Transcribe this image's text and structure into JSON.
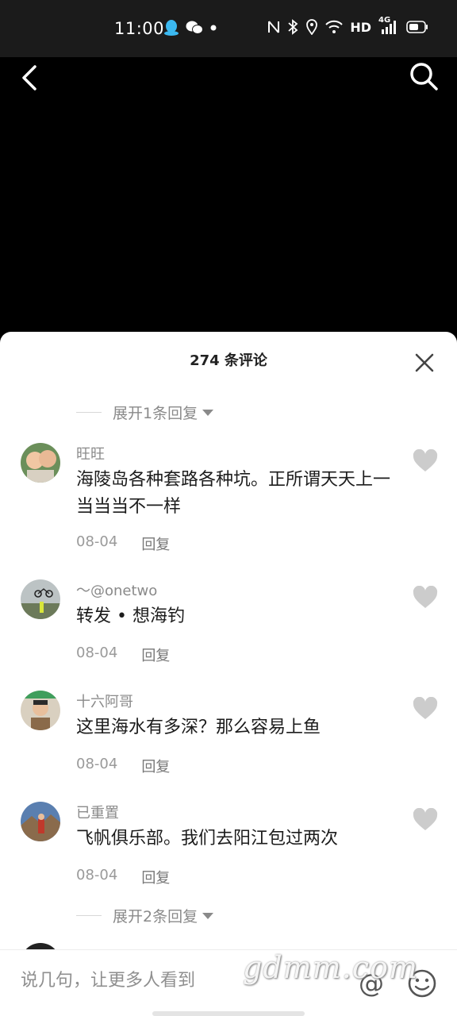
{
  "status_bar": {
    "time": "11:00",
    "icons_left": [
      "qq-icon",
      "wechat-icon",
      "dot-icon"
    ],
    "icons_right": [
      "nfc-icon",
      "bluetooth-icon",
      "location-icon",
      "wifi-icon",
      "hd-badge",
      "signal-4g-icon",
      "battery-icon"
    ],
    "hd_label": "HD",
    "net_label": "4G"
  },
  "header": {
    "back_icon": "chevron-left-icon",
    "search_icon": "search-icon"
  },
  "comments_sheet": {
    "title": "274 条评论",
    "close_icon": "close-icon",
    "expand_top": "展开1条回复",
    "expand_bottom": "展开2条回复",
    "items": [
      {
        "name": "旺旺",
        "text": "海陵岛各种套路各种坑。正所谓天天上一当当当不一样",
        "date": "08-04",
        "reply": "回复"
      },
      {
        "name": "～@onetwo",
        "text": "转发 • 想海钓",
        "date": "08-04",
        "reply": "回复"
      },
      {
        "name": "十六阿哥",
        "text": "这里海水有多深？那么容易上鱼",
        "date": "08-04",
        "reply": "回复"
      },
      {
        "name": "已重置",
        "text": "飞帆俱乐部。我们去阳江包过两次",
        "date": "08-04",
        "reply": "回复"
      }
    ]
  },
  "input_bar": {
    "placeholder": "说几句，让更多人看到",
    "at_symbol": "@",
    "emoji_icon": "smiley-icon",
    "watermark": "gdmm.com"
  },
  "colors": {
    "sheet_bg": "#ffffff",
    "video_bg": "#000000",
    "meta_gray": "#9a9a9a",
    "heart_gray": "#cccccc"
  }
}
